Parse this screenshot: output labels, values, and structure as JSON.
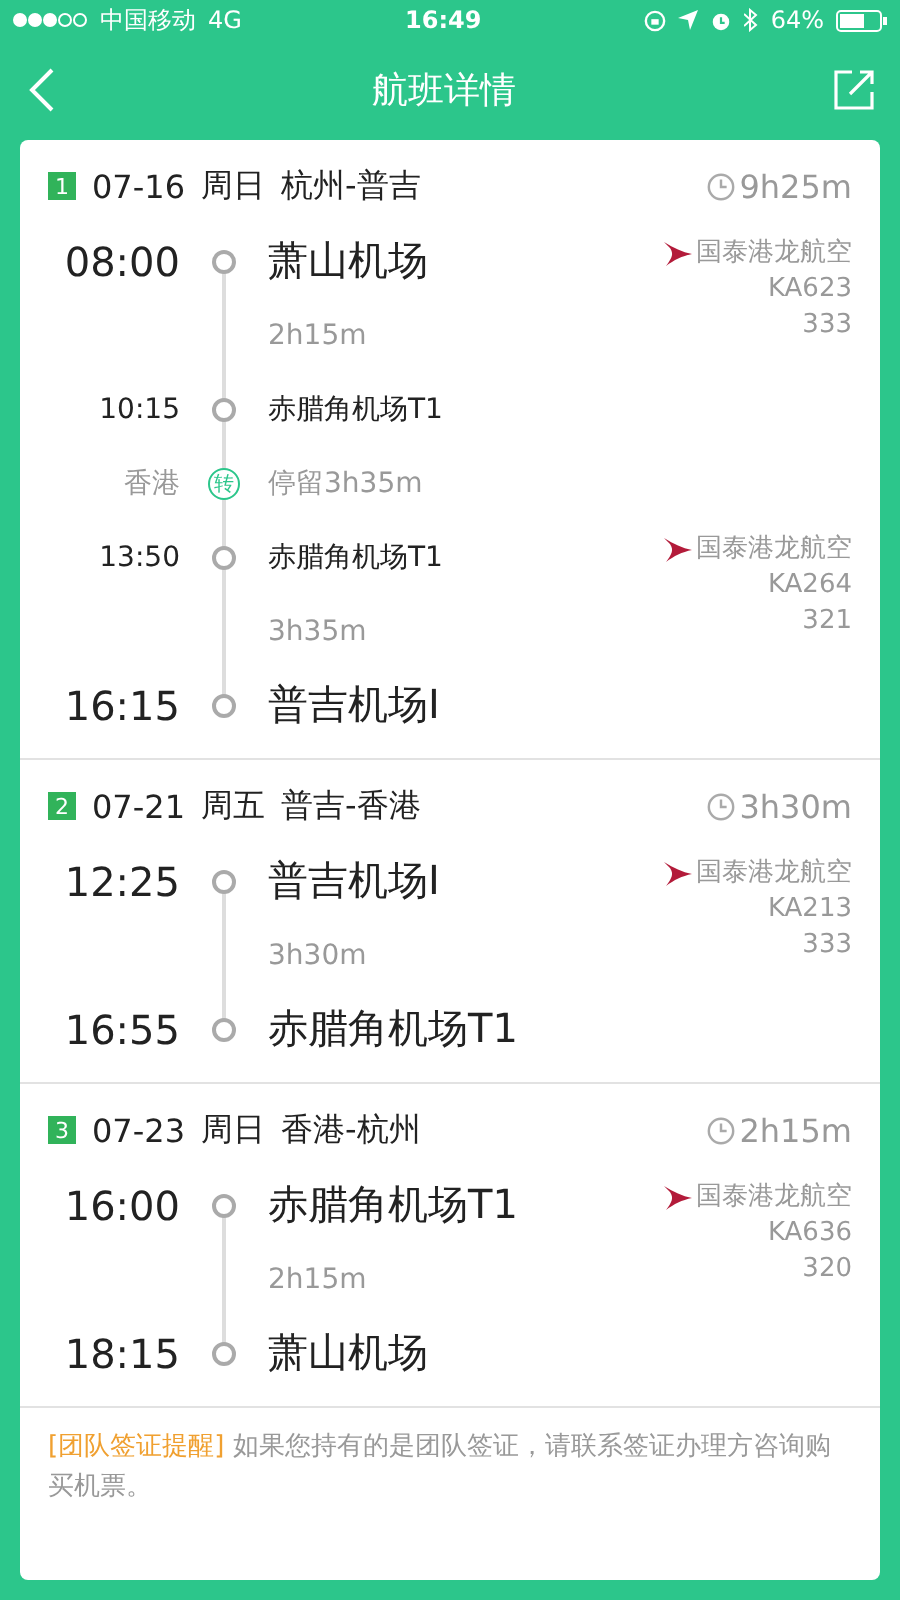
{
  "status_bar": {
    "carrier": "中国移动",
    "network": "4G",
    "time": "16:49",
    "battery": "64%"
  },
  "nav": {
    "title": "航班详情"
  },
  "segments": [
    {
      "index": "1",
      "date": "07-16",
      "weekday": "周日",
      "route": "杭州-普吉",
      "duration": "9h25m",
      "timeline": [
        {
          "kind": "stop",
          "time": "08:00",
          "airport": "萧山机场",
          "airline": {
            "name": "国泰港龙航空",
            "flight": "KA623",
            "aircraft": "333"
          }
        },
        {
          "kind": "leg",
          "duration": "2h15m"
        },
        {
          "kind": "via",
          "time": "10:15",
          "airport": "赤腊角机场T1"
        },
        {
          "kind": "transfer",
          "city": "香港",
          "badge": "转",
          "text": "停留3h35m"
        },
        {
          "kind": "via",
          "time": "13:50",
          "airport": "赤腊角机场T1",
          "airline": {
            "name": "国泰港龙航空",
            "flight": "KA264",
            "aircraft": "321"
          }
        },
        {
          "kind": "leg",
          "duration": "3h35m"
        },
        {
          "kind": "stop",
          "time": "16:15",
          "airport": "普吉机场I"
        }
      ]
    },
    {
      "index": "2",
      "date": "07-21",
      "weekday": "周五",
      "route": "普吉-香港",
      "duration": "3h30m",
      "timeline": [
        {
          "kind": "stop",
          "time": "12:25",
          "airport": "普吉机场I",
          "airline": {
            "name": "国泰港龙航空",
            "flight": "KA213",
            "aircraft": "333"
          }
        },
        {
          "kind": "leg",
          "duration": "3h30m"
        },
        {
          "kind": "stop",
          "time": "16:55",
          "airport": "赤腊角机场T1"
        }
      ]
    },
    {
      "index": "3",
      "date": "07-23",
      "weekday": "周日",
      "route": "香港-杭州",
      "duration": "2h15m",
      "timeline": [
        {
          "kind": "stop",
          "time": "16:00",
          "airport": "赤腊角机场T1",
          "airline": {
            "name": "国泰港龙航空",
            "flight": "KA636",
            "aircraft": "320"
          }
        },
        {
          "kind": "leg",
          "duration": "2h15m"
        },
        {
          "kind": "stop",
          "time": "18:15",
          "airport": "萧山机场"
        }
      ]
    }
  ],
  "notice": {
    "tag": "[团队签证提醒]",
    "text": "如果您持有的是团队签证，请联系签证办理方咨询购买机票。"
  }
}
